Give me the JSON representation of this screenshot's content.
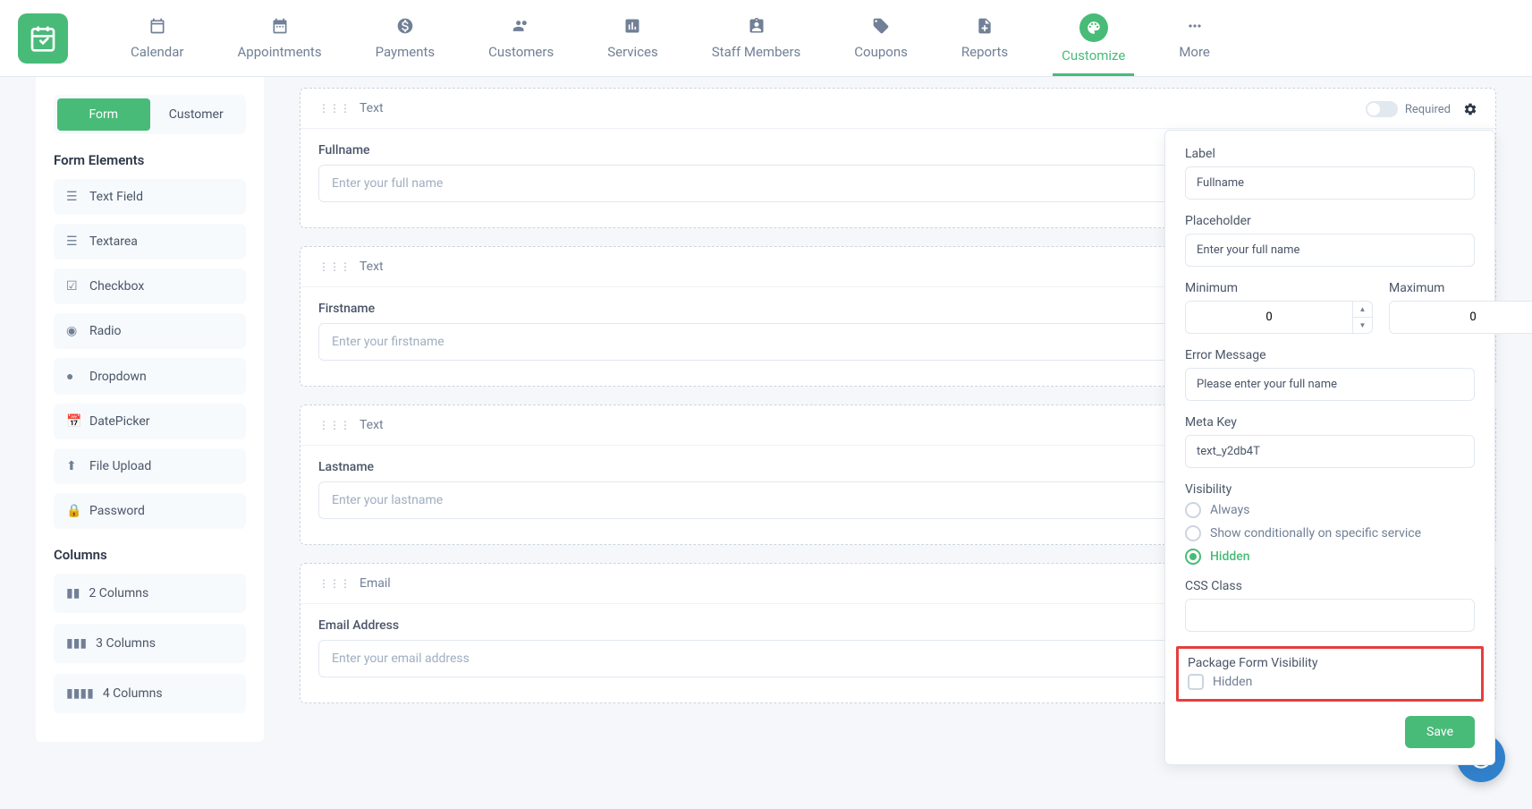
{
  "nav": {
    "items": [
      {
        "label": "Calendar"
      },
      {
        "label": "Appointments"
      },
      {
        "label": "Payments"
      },
      {
        "label": "Customers"
      },
      {
        "label": "Services"
      },
      {
        "label": "Staff Members"
      },
      {
        "label": "Coupons"
      },
      {
        "label": "Reports"
      },
      {
        "label": "Customize"
      },
      {
        "label": "More"
      }
    ]
  },
  "sidebar": {
    "tabs": {
      "form": "Form",
      "customer": "Customer"
    },
    "form_elements_title": "Form Elements",
    "elements": [
      {
        "label": "Text Field"
      },
      {
        "label": "Textarea"
      },
      {
        "label": "Checkbox"
      },
      {
        "label": "Radio"
      },
      {
        "label": "Dropdown"
      },
      {
        "label": "DatePicker"
      },
      {
        "label": "File Upload"
      },
      {
        "label": "Password"
      }
    ],
    "columns_title": "Columns",
    "columns": [
      {
        "label": "2 Columns"
      },
      {
        "label": "3 Columns"
      },
      {
        "label": "4 Columns"
      }
    ]
  },
  "canvas": {
    "fields": [
      {
        "type": "Text",
        "label": "Fullname",
        "placeholder": "Enter your full name",
        "required_label": "Required"
      },
      {
        "type": "Text",
        "label": "Firstname",
        "placeholder": "Enter your firstname"
      },
      {
        "type": "Text",
        "label": "Lastname",
        "placeholder": "Enter your lastname"
      },
      {
        "type": "Email",
        "label": "Email Address",
        "placeholder": "Enter your email address"
      }
    ]
  },
  "settings": {
    "label_title": "Label",
    "label_value": "Fullname",
    "placeholder_title": "Placeholder",
    "placeholder_value": "Enter your full name",
    "minimum_title": "Minimum",
    "minimum_value": "0",
    "maximum_title": "Maximum",
    "maximum_value": "0",
    "error_title": "Error Message",
    "error_value": "Please enter your full name",
    "meta_title": "Meta Key",
    "meta_value": "text_y2db4T",
    "visibility_title": "Visibility",
    "visibility_options": {
      "always": "Always",
      "conditional": "Show conditionally on specific service",
      "hidden": "Hidden"
    },
    "css_title": "CSS Class",
    "css_value": "",
    "package_title": "Package Form Visibility",
    "package_hidden": "Hidden",
    "save_btn": "Save"
  }
}
